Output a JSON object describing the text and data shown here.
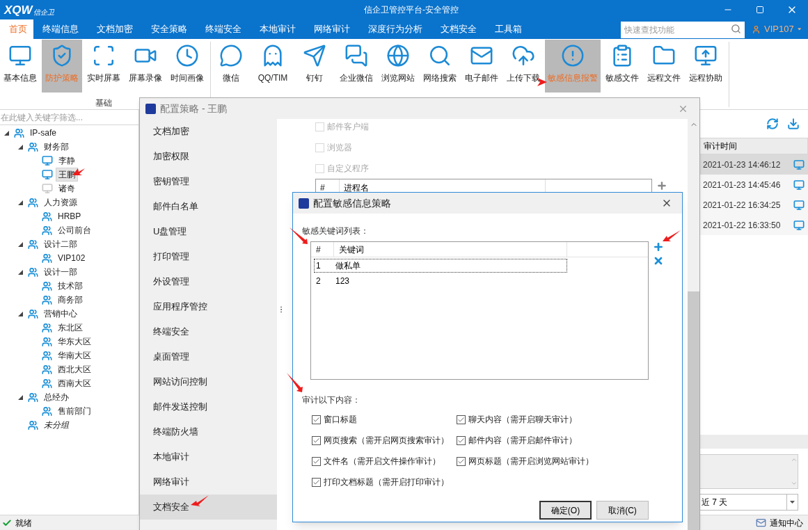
{
  "window": {
    "logo": "XQW",
    "logo_tagline": "信企卫",
    "title": "信企卫管控平台-安全管控"
  },
  "menu_tabs": [
    {
      "label": "首页",
      "selected": true
    },
    {
      "label": "终端信息",
      "selected": false
    },
    {
      "label": "文档加密",
      "selected": false
    },
    {
      "label": "安全策略",
      "selected": false
    },
    {
      "label": "终端安全",
      "selected": false
    },
    {
      "label": "本地审计",
      "selected": false
    },
    {
      "label": "网络审计",
      "selected": false
    },
    {
      "label": "深度行为分析",
      "selected": false
    },
    {
      "label": "文档安全",
      "selected": false
    },
    {
      "label": "工具箱",
      "selected": false
    }
  ],
  "search": {
    "placeholder": "快速查找功能"
  },
  "user": {
    "name": "VIP107"
  },
  "ribbon": {
    "groups": [
      {
        "label": "基础",
        "items": [
          {
            "label": "基本信息",
            "selected": false
          },
          {
            "label": "防护策略",
            "selected": true
          },
          {
            "label": "实时屏幕",
            "selected": false
          },
          {
            "label": "屏幕录像",
            "selected": false
          },
          {
            "label": "时间画像",
            "selected": false
          }
        ]
      },
      {
        "items": [
          {
            "label": "微信",
            "selected": false
          },
          {
            "label": "QQ/TIM",
            "selected": false
          },
          {
            "label": "钉钉",
            "selected": false
          },
          {
            "label": "企业微信",
            "selected": false
          },
          {
            "label": "浏览网站",
            "selected": false
          },
          {
            "label": "网络搜索",
            "selected": false
          },
          {
            "label": "电子邮件",
            "selected": false
          },
          {
            "label": "上传下载",
            "selected": false
          },
          {
            "label": "敏感信息报警",
            "selected": true
          },
          {
            "label": "敏感文件",
            "selected": false
          },
          {
            "label": "远程文件",
            "selected": false
          },
          {
            "label": "远程协助",
            "selected": false
          }
        ]
      }
    ]
  },
  "tree": {
    "filter_placeholder": "在此键入关键字筛选...",
    "nodes": [
      {
        "label": "IP-safe",
        "kind": "group",
        "expanded": true,
        "children": [
          {
            "label": "财务部",
            "kind": "group",
            "expanded": true,
            "children": [
              {
                "label": "李静",
                "kind": "computer",
                "online": true,
                "selected": false
              },
              {
                "label": "王鹏",
                "kind": "computer",
                "online": true,
                "selected": true
              },
              {
                "label": "诸奇",
                "kind": "computer",
                "online": false,
                "selected": false
              }
            ]
          },
          {
            "label": "人力资源",
            "kind": "group",
            "expanded": true,
            "children": [
              {
                "label": "HRBP",
                "kind": "user"
              },
              {
                "label": "公司前台",
                "kind": "user"
              }
            ]
          },
          {
            "label": "设计二部",
            "kind": "group",
            "expanded": true,
            "children": [
              {
                "label": "VIP102",
                "kind": "user"
              }
            ]
          },
          {
            "label": "设计一部",
            "kind": "group",
            "expanded": true,
            "children": [
              {
                "label": "技术部",
                "kind": "user"
              },
              {
                "label": "商务部",
                "kind": "user"
              }
            ]
          },
          {
            "label": "营销中心",
            "kind": "group",
            "expanded": true,
            "children": [
              {
                "label": "东北区",
                "kind": "user"
              },
              {
                "label": "华东大区",
                "kind": "user"
              },
              {
                "label": "华南大区",
                "kind": "user"
              },
              {
                "label": "西北大区",
                "kind": "user"
              },
              {
                "label": "西南大区",
                "kind": "user"
              }
            ]
          },
          {
            "label": "总经办",
            "kind": "group",
            "expanded": true,
            "children": [
              {
                "label": "售前部门",
                "kind": "user"
              }
            ]
          },
          {
            "label": "未分组",
            "kind": "ungrouped"
          }
        ]
      }
    ]
  },
  "audit_table": {
    "columns": [
      "审计时间"
    ],
    "rows": [
      {
        "time": "2021-01-23 14:46:12",
        "selected": true
      },
      {
        "time": "2021-01-23 14:45:46",
        "selected": false
      },
      {
        "time": "2021-01-22 16:34:25",
        "selected": false
      },
      {
        "time": "2021-01-22 16:33:50",
        "selected": false
      }
    ]
  },
  "range_select": {
    "value": "近 7 天"
  },
  "status_bar": {
    "status": "就绪",
    "notifications": "通知中心"
  },
  "policy_dialog": {
    "title": "配置策略 - 王鹏",
    "menu": [
      {
        "label": "文档加密",
        "selected": false
      },
      {
        "label": "加密权限",
        "selected": false
      },
      {
        "label": "密钥管理",
        "selected": false
      },
      {
        "label": "邮件白名单",
        "selected": false
      },
      {
        "label": "U盘管理",
        "selected": false
      },
      {
        "label": "打印管理",
        "selected": false
      },
      {
        "label": "外设管理",
        "selected": false
      },
      {
        "label": "应用程序管控",
        "selected": false
      },
      {
        "label": "终端安全",
        "selected": false
      },
      {
        "label": "桌面管理",
        "selected": false
      },
      {
        "label": "网站访问控制",
        "selected": false
      },
      {
        "label": "邮件发送控制",
        "selected": false
      },
      {
        "label": "终端防火墙",
        "selected": false
      },
      {
        "label": "本地审计",
        "selected": false
      },
      {
        "label": "网络审计",
        "selected": false
      },
      {
        "label": "文档安全",
        "selected": true
      }
    ],
    "options": [
      {
        "label": "邮件客户端",
        "checked": false,
        "disabled": true
      },
      {
        "label": "浏览器",
        "checked": false,
        "disabled": true
      },
      {
        "label": "自定义程序",
        "checked": false,
        "disabled": true
      }
    ],
    "process_columns": [
      "#",
      "进程名"
    ]
  },
  "sensitive_dialog": {
    "title": "配置敏感信息策略",
    "keywords_label": "敏感关键词列表：",
    "keyword_columns": [
      "#",
      "关键词"
    ],
    "keywords": [
      {
        "index": "1",
        "keyword": "做私单",
        "focused": true
      },
      {
        "index": "2",
        "keyword": "123",
        "focused": false
      }
    ],
    "audit_label": "审计以下内容：",
    "audit_options": [
      {
        "label": "窗口标题",
        "checked": true
      },
      {
        "label": "聊天内容（需开启聊天审计）",
        "checked": true
      },
      {
        "label": "网页搜索（需开启网页搜索审计）",
        "checked": true
      },
      {
        "label": "邮件内容（需开启邮件审计）",
        "checked": true
      },
      {
        "label": "文件名（需开启文件操作审计）",
        "checked": true
      },
      {
        "label": "网页标题（需开启浏览网站审计）",
        "checked": true
      },
      {
        "label": "打印文档标题（需开启打印审计）",
        "checked": true
      }
    ],
    "buttons": [
      "确定(O)",
      "取消(C)"
    ]
  }
}
